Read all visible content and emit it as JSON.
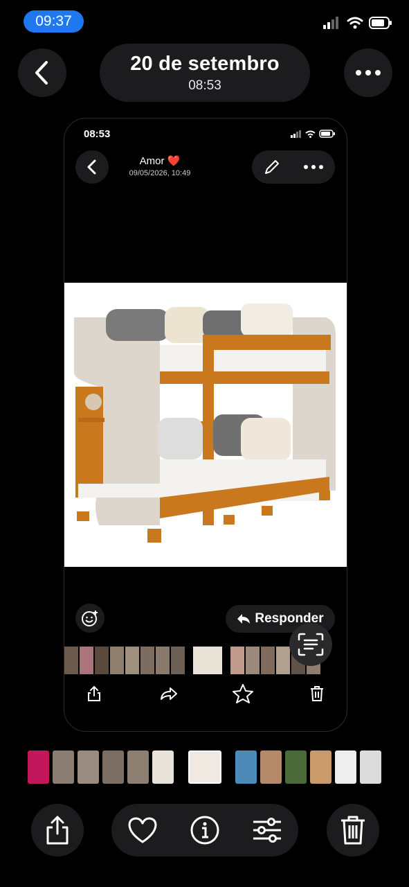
{
  "status_bar": {
    "time": "09:37"
  },
  "header": {
    "title": "20 de setembro",
    "subtitle": "08:53"
  },
  "inner_screenshot": {
    "time": "08:53",
    "contact_name": "Amor ❤️",
    "message_date": "09/05/2026, 10:49",
    "reply_label": "Responder"
  },
  "icons": {
    "back": "chevron-left-icon",
    "more": "ellipsis-icon",
    "share": "share-icon",
    "favorite": "heart-icon",
    "info": "info-icon",
    "adjust": "sliders-icon",
    "delete": "trash-icon"
  },
  "colors": {
    "accent": "#1e78f0",
    "background": "#000000",
    "surface": "#1c1c1e"
  }
}
